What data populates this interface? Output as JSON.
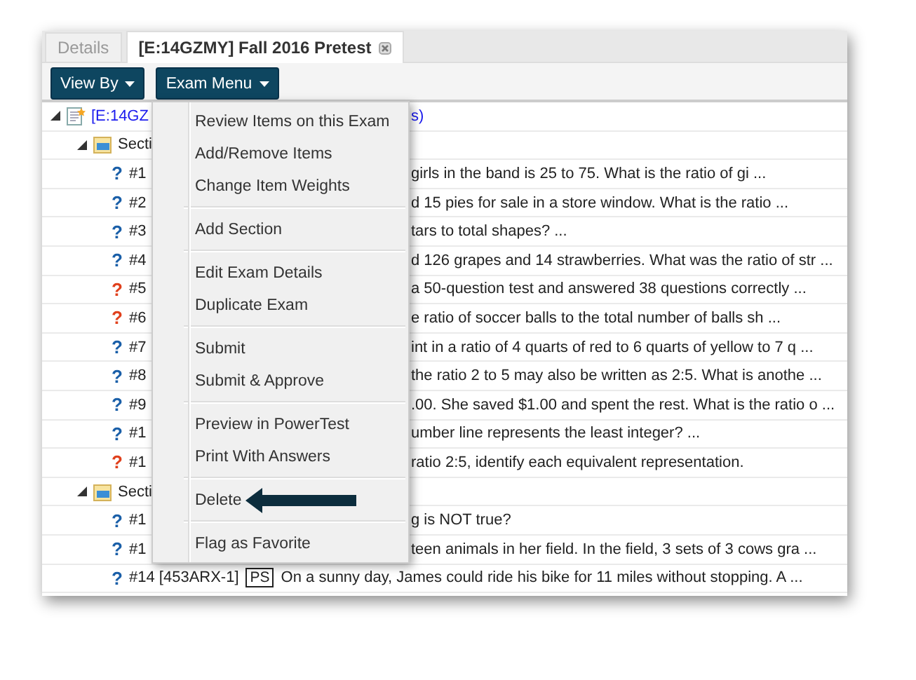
{
  "tabs": [
    {
      "label": "Details",
      "selected": false,
      "closable": false
    },
    {
      "label": "[E:14GZMY] Fall 2016 Pretest",
      "selected": true,
      "closable": true
    }
  ],
  "toolbar": {
    "buttons": [
      "View By",
      "Exam Menu"
    ]
  },
  "tree": {
    "expanded": true,
    "label": "[E:14GZ",
    "label_end": "s)",
    "sections": [
      {
        "expanded": true,
        "label": "Secti",
        "items": [
          {
            "kind": "partial",
            "icon": "?",
            "color": "#1a5fa8",
            "number": "#1",
            "text": "girls in the band is 25 to 75. What is the ratio of gi ..."
          },
          {
            "kind": "partial",
            "icon": "?",
            "color": "#1a5fa8",
            "number": "#2",
            "text": "d 15 pies for sale in a store window. What is the ratio ..."
          },
          {
            "kind": "partial",
            "icon": "?",
            "color": "#1a5fa8",
            "number": "#3",
            "text": "tars to total shapes? ..."
          },
          {
            "kind": "partial",
            "icon": "?",
            "color": "#1a5fa8",
            "number": "#4",
            "text": "d 126 grapes and 14 strawberries. What was the ratio of str ..."
          },
          {
            "kind": "partial",
            "icon": "?",
            "color": "#e0401c",
            "number": "#5",
            "text": "a 50-question test and answered 38 questions correctly ..."
          },
          {
            "kind": "partial",
            "icon": "?",
            "color": "#e0401c",
            "number": "#6",
            "text": "e ratio of soccer balls to the total number of balls sh ..."
          },
          {
            "kind": "partial",
            "icon": "?",
            "color": "#1a5fa8",
            "number": "#7",
            "text": "int in a ratio of 4 quarts of red to 6 quarts of yellow to 7 q ..."
          },
          {
            "kind": "partial",
            "icon": "?",
            "color": "#1a5fa8",
            "number": "#8",
            "text": "the ratio 2 to 5 may also be written as 2:5. What is anothe ..."
          },
          {
            "kind": "partial",
            "icon": "?",
            "color": "#1a5fa8",
            "number": "#9",
            "text": ".00. She saved $1.00 and spent the rest. What is the ratio o ..."
          },
          {
            "kind": "partial",
            "icon": "?",
            "color": "#1a5fa8",
            "number": "#1",
            "text": "umber line represents the least integer? ..."
          },
          {
            "kind": "partial",
            "icon": "?",
            "color": "#e0401c",
            "number": "#1",
            "text": "ratio 2:5, identify each equivalent representation."
          }
        ]
      },
      {
        "expanded": true,
        "label": "Secti",
        "items": [
          {
            "kind": "partial",
            "icon": "?",
            "color": "#1a5fa8",
            "number": "#1",
            "text": "g is NOT true?"
          },
          {
            "kind": "partial",
            "icon": "?",
            "color": "#1a5fa8",
            "number": "#1",
            "text": "teen animals in her field. In the field, 3 sets of 3 cows gra ..."
          },
          {
            "kind": "full",
            "icon": "?",
            "color": "#1a5fa8",
            "number": "#14 [453ARX-1]",
            "tag": "PS",
            "text": "On a sunny day, James could ride his bike for 11 miles without stopping. A ..."
          }
        ]
      }
    ]
  },
  "exam_menu": {
    "open": true,
    "groups": [
      [
        "Review Items on this Exam",
        "Add/Remove Items",
        "Change Item Weights"
      ],
      [
        "Add Section"
      ],
      [
        "Edit Exam Details",
        "Duplicate Exam"
      ],
      [
        "Submit",
        "Submit & Approve"
      ],
      [
        "Preview in PowerTest",
        "Print With Answers"
      ],
      [
        "Delete"
      ],
      [
        "Flag as Favorite"
      ]
    ]
  }
}
